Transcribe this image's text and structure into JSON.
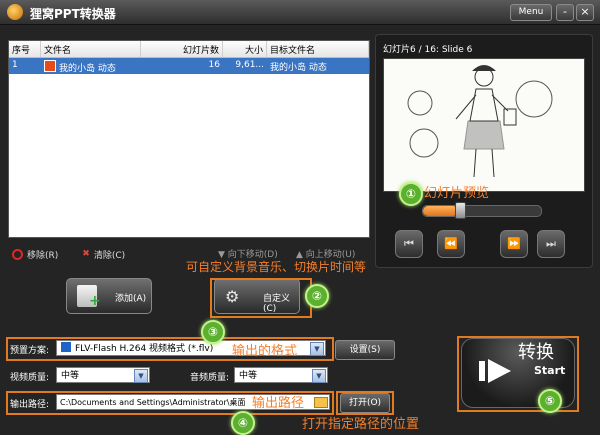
{
  "app": {
    "title": "狸窝PPT转换器",
    "menu_label": "Menu",
    "minimize": "-",
    "close": "×"
  },
  "list": {
    "columns": [
      "序号",
      "文件名",
      "幻灯片数",
      "大小",
      "目标文件名"
    ],
    "rows": [
      {
        "index": "1",
        "filename": "我的小岛 动态",
        "slides": "16",
        "size": "9,61...",
        "target": "我的小岛 动态"
      }
    ]
  },
  "preview": {
    "slide_label": "幻灯片6 / 16: Slide 6",
    "progress": 0.3,
    "buttons": [
      "⏮",
      "⏪",
      "⏩",
      "⏭"
    ]
  },
  "toolbar": {
    "remove": "移除(R)",
    "clear": "清除(C)",
    "move_down": "向下移动(D)",
    "move_up": "向上移动(U)"
  },
  "buttons": {
    "add": "添加(A)",
    "custom": "自定义(C)",
    "settings": "设置(S)",
    "open": "打开(O)",
    "start": "Start"
  },
  "form": {
    "preset_label": "预置方案:",
    "preset_value": "FLV-Flash H.264 视频格式 (*.flv)",
    "video_quality_label": "视频质量:",
    "video_quality_value": "中等",
    "audio_quality_label": "音频质量:",
    "audio_quality_value": "中等",
    "output_path_label": "输出路径:",
    "output_path_value": "C:\\Documents and Settings\\Administrator\\桌面"
  },
  "annotations": {
    "preview": "幻灯片预览",
    "custom": "可自定义背景音乐、切换片时间等",
    "format": "输出的格式",
    "path": "输出路径",
    "open": "打开指定路径的位置",
    "convert": "转换"
  },
  "badges": [
    "①",
    "②",
    "③",
    "④",
    "⑤"
  ],
  "colors": {
    "accent_orange": "#f57f2b",
    "badge_green": "#5bb02e",
    "selection_blue": "#3a75c4"
  }
}
